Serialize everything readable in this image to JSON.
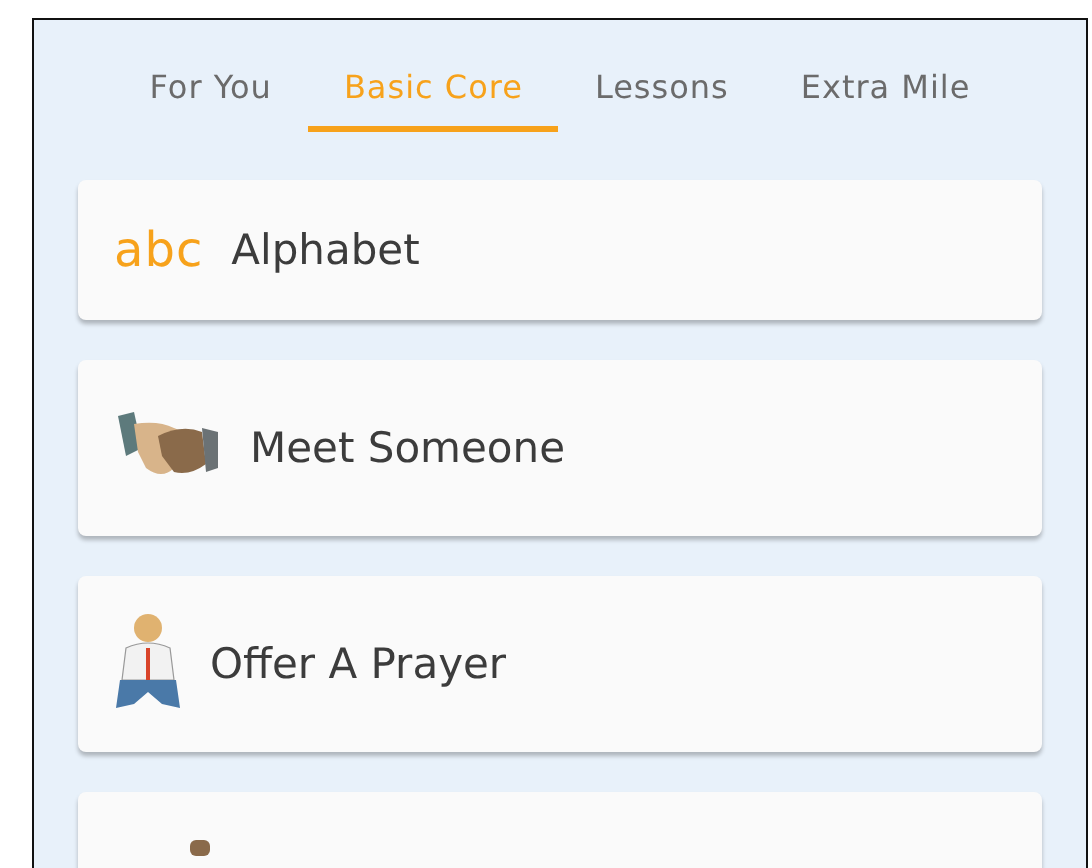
{
  "tabs": [
    {
      "label": "For You",
      "selected": false
    },
    {
      "label": "Basic Core",
      "selected": true
    },
    {
      "label": "Lessons",
      "selected": false
    },
    {
      "label": "Extra Mile",
      "selected": false
    }
  ],
  "cards": [
    {
      "kind": "text-icon",
      "icon_text": "abc",
      "title": "Alphabet"
    },
    {
      "kind": "handshake",
      "title": "Meet Someone"
    },
    {
      "kind": "praying",
      "title": "Offer A Prayer"
    },
    {
      "kind": "partial"
    }
  ]
}
